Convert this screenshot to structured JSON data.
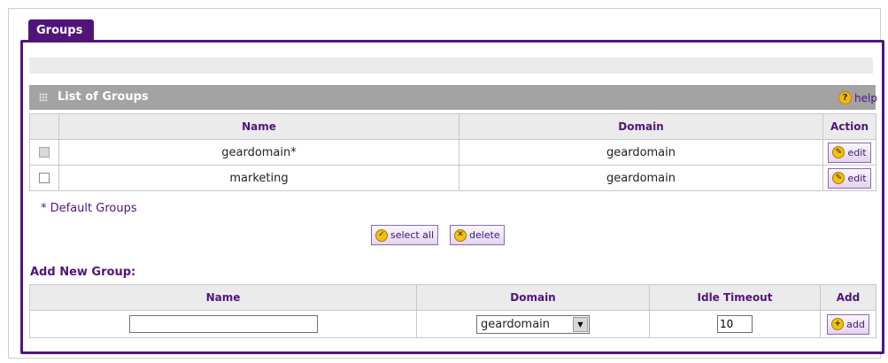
{
  "tab": {
    "label": "Groups"
  },
  "list_section": {
    "title": "List of Groups",
    "help_label": "help",
    "help_icon": "question-icon",
    "columns": [
      "Name",
      "Domain",
      "Action"
    ],
    "rows": [
      {
        "name": "geardomain*",
        "domain": "geardomain",
        "action": "edit",
        "checkbox_disabled": true
      },
      {
        "name": "marketing",
        "domain": "geardomain",
        "action": "edit",
        "checkbox_disabled": false
      }
    ],
    "footnote": "* Default Groups",
    "select_all_label": "select all",
    "delete_label": "delete"
  },
  "add_section": {
    "title": "Add New Group:",
    "columns": [
      "Name",
      "Domain",
      "Idle Timeout",
      "Add"
    ],
    "name_value": "",
    "domain_selected": "geardomain",
    "idle_timeout_value": "10",
    "add_label": "add"
  },
  "colors": {
    "accent": "#51157a",
    "header_gray": "#a3a3a3",
    "icon_yellow": "#f2c20f"
  }
}
